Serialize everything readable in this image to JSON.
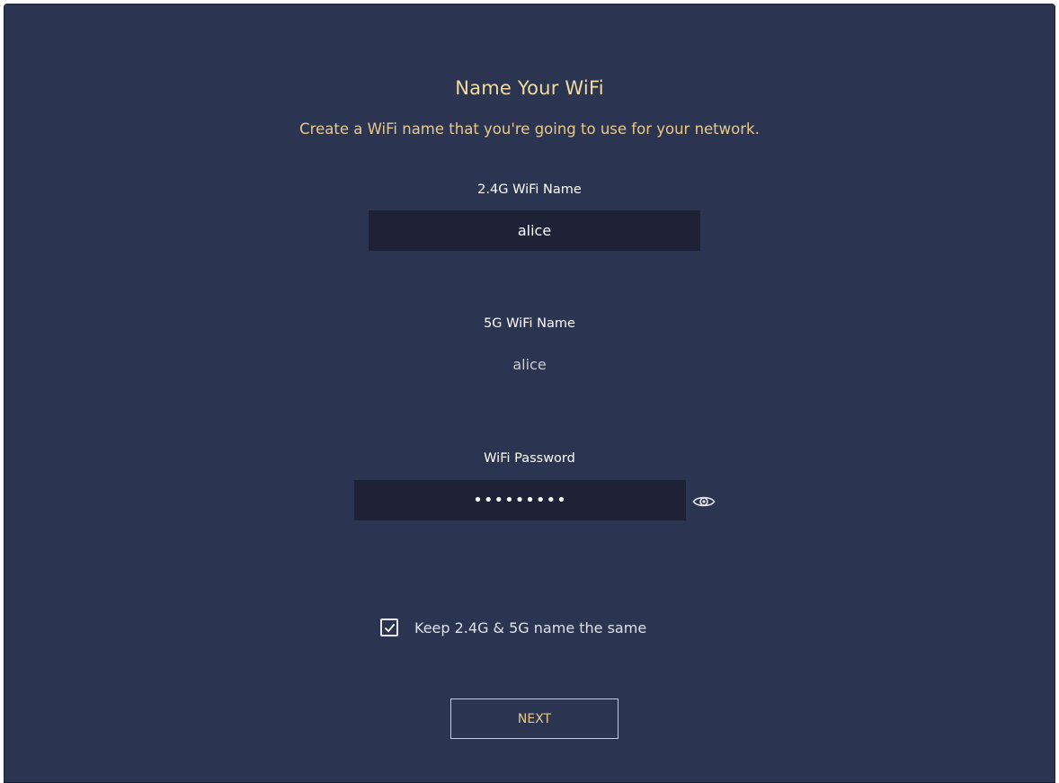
{
  "page": {
    "title": "Name Your WiFi",
    "subtitle": "Create a WiFi name that you're going to use for your network."
  },
  "wifi24": {
    "label": "2.4G WiFi Name",
    "value": "alice"
  },
  "wifi5": {
    "label": "5G WiFi Name",
    "value": "alice"
  },
  "password": {
    "label": "WiFi Password",
    "masked_value": "•••••••••",
    "toggle_icon": "eye-icon"
  },
  "keep_same": {
    "label": "Keep 2.4G & 5G name the same",
    "checked": true
  },
  "actions": {
    "next_label": "NEXT"
  },
  "colors": {
    "background": "#2b3552",
    "field_background": "#1e2236",
    "accent": "#e8c98a",
    "title": "#f2dca0"
  }
}
